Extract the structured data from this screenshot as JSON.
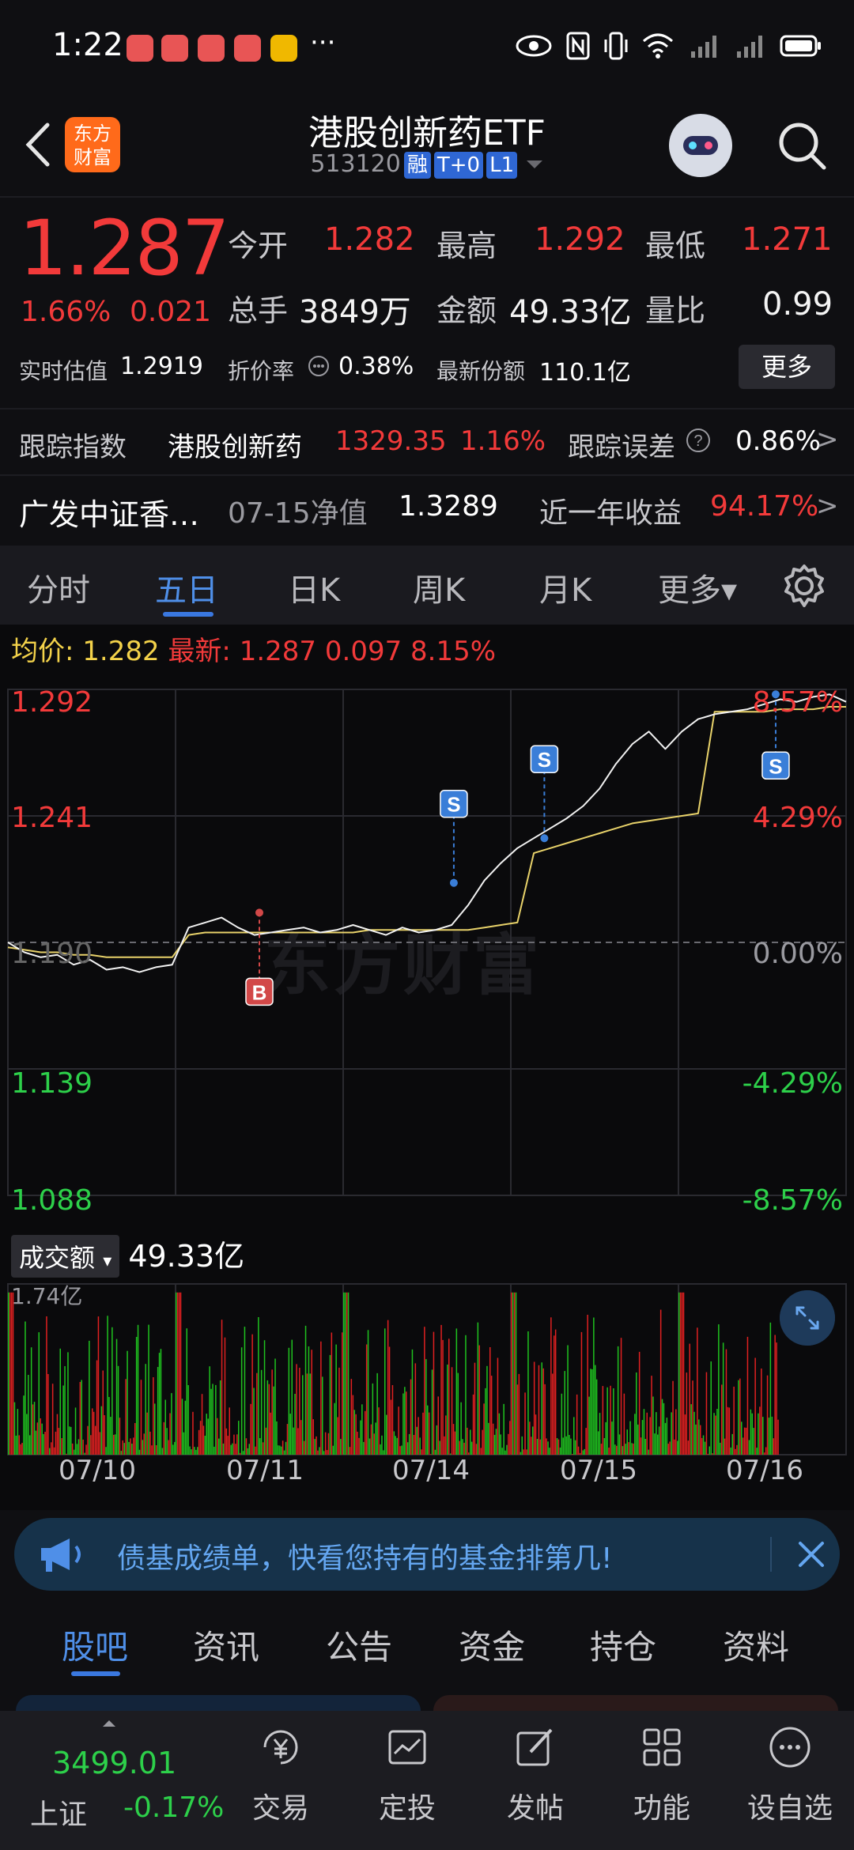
{
  "status_bar": {
    "time": "1:22",
    "ellipsis": "···",
    "icons": [
      "eye-icon",
      "nfc-icon",
      "vibrate-icon",
      "wifi-icon",
      "signal-icon",
      "signal-icon",
      "battery-icon"
    ]
  },
  "header": {
    "logo_line1": "东方",
    "logo_line2": "财富",
    "title": "港股创新药ETF",
    "code": "513120",
    "tags": [
      "融",
      "T+0",
      "L1"
    ]
  },
  "quote": {
    "last": "1.287",
    "pct": "1.66%",
    "change": "0.021",
    "open_label": "今开",
    "open": "1.282",
    "high_label": "最高",
    "high": "1.292",
    "low_label": "最低",
    "low": "1.271",
    "volume_label": "总手",
    "volume": "3849万",
    "amount_label": "金额",
    "amount": "49.33亿",
    "ratio_label": "量比",
    "ratio": "0.99",
    "iopv_label": "实时估值",
    "iopv": "1.2919",
    "premium_label": "折价率",
    "premium": "0.38%",
    "shares_label": "最新份额",
    "shares": "110.1亿",
    "more_label": "更多"
  },
  "tracking": {
    "label": "跟踪指数",
    "index_name": "港股创新药",
    "index_value": "1329.35",
    "index_pct": "1.16%",
    "error_label": "跟踪误差",
    "error_value": "0.86%",
    "arrow": ">"
  },
  "fund": {
    "name": "广发中证香…",
    "nav_label": "07-15净值",
    "nav": "1.3289",
    "year_label": "近一年收益",
    "year_return": "94.17%",
    "arrow": ">"
  },
  "tabs": [
    "分时",
    "五日",
    "日K",
    "周K",
    "月K",
    "更多▾"
  ],
  "active_tab": "五日",
  "chart_head": {
    "avg_label": "均价:",
    "avg": "1.282",
    "latest_label": "最新:",
    "latest": "1.287",
    "change": "0.097",
    "pct": "8.15%"
  },
  "watermark": "东方财富",
  "chart_data": {
    "type": "line",
    "x_labels": [
      "07/10",
      "07/11",
      "07/14",
      "07/15",
      "07/16"
    ],
    "y_left_ticks": [
      "1.292",
      "1.241",
      "1.190",
      "1.139",
      "1.088"
    ],
    "y_right_ticks": [
      "8.57%",
      "4.29%",
      "0.00%",
      "-4.29%",
      "-8.57%"
    ],
    "ylim": [
      1.088,
      1.292
    ],
    "prev_close": 1.19,
    "series": [
      {
        "name": "最新",
        "values": [
          1.19,
          1.186,
          1.184,
          1.185,
          1.181,
          1.183,
          1.179,
          1.18,
          1.178,
          1.18,
          1.181,
          1.196,
          1.198,
          1.2,
          1.196,
          1.193,
          1.194,
          1.195,
          1.196,
          1.194,
          1.195,
          1.197,
          1.195,
          1.193,
          1.196,
          1.194,
          1.195,
          1.197,
          1.205,
          1.215,
          1.222,
          1.228,
          1.232,
          1.236,
          1.24,
          1.245,
          1.252,
          1.262,
          1.27,
          1.275,
          1.268,
          1.275,
          1.28,
          1.282,
          1.283,
          1.284,
          1.286,
          1.288,
          1.287,
          1.289,
          1.29,
          1.287
        ]
      },
      {
        "name": "均价",
        "values": [
          1.188,
          1.187,
          1.186,
          1.186,
          1.185,
          1.185,
          1.184,
          1.184,
          1.184,
          1.184,
          1.184,
          1.193,
          1.194,
          1.194,
          1.194,
          1.194,
          1.194,
          1.194,
          1.194,
          1.194,
          1.194,
          1.194,
          1.195,
          1.195,
          1.195,
          1.195,
          1.195,
          1.195,
          1.195,
          1.196,
          1.197,
          1.198,
          1.226,
          1.228,
          1.23,
          1.232,
          1.234,
          1.236,
          1.238,
          1.239,
          1.24,
          1.241,
          1.242,
          1.283,
          1.283,
          1.283,
          1.283,
          1.284,
          1.284,
          1.284,
          1.285,
          1.285
        ]
      }
    ],
    "markers": [
      {
        "label": "B",
        "day": 1,
        "value": 1.202
      },
      {
        "label": "S",
        "day": 2,
        "value": 1.214
      },
      {
        "label": "S",
        "day": 3,
        "value": 1.232
      },
      {
        "label": "S",
        "day": 4,
        "value": 1.29
      }
    ],
    "volume": {
      "label": "成交额",
      "total": "49.33亿",
      "max_label": "1.74亿"
    }
  },
  "banner": {
    "text": "债基成绩单，快看您持有的基金排第几!"
  },
  "bottom_tabs": [
    "股吧",
    "资讯",
    "公告",
    "资金",
    "持仓",
    "资料"
  ],
  "index_bar": {
    "value": "3499.01",
    "name": "上证",
    "pct": "-0.17%"
  },
  "nav": [
    "交易",
    "定投",
    "发帖",
    "功能",
    "设自选"
  ],
  "colors": {
    "up": "#f23a3a",
    "down": "#2dd04a",
    "accent": "#3a78e0",
    "avg_line": "#e8d26a"
  }
}
